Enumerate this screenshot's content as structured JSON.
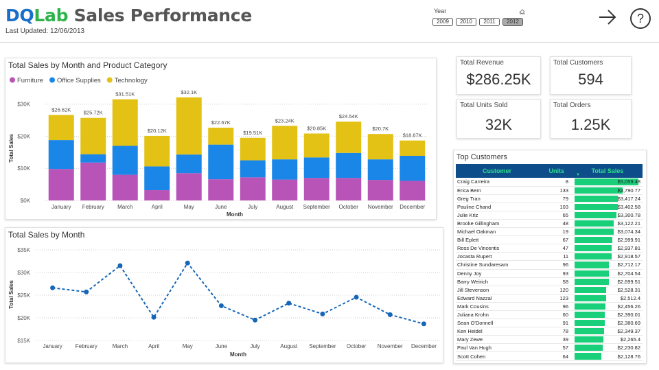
{
  "header": {
    "title_a": "DQ",
    "title_b": "Lab",
    "title_c": " Sales Performance",
    "last_updated": "Last Updated: 12/06/2013"
  },
  "slicer": {
    "label": "Year",
    "options": [
      "2009",
      "2010",
      "2011",
      "2012"
    ],
    "selected": "2012"
  },
  "colors": {
    "furniture": "#b854b8",
    "office": "#1a86e8",
    "technology": "#e3c115",
    "line": "#1566b8",
    "bar_green": "#19cf79",
    "table_header_bg": "#0d4d8a",
    "table_header_fg": "#2fe08a"
  },
  "icons": {
    "arrow": "arrow-right-icon",
    "help": "question-circle-icon",
    "eraser": "eraser-icon"
  },
  "kpis": [
    {
      "title": "Total Revenue",
      "value": "$286.25K"
    },
    {
      "title": "Total Customers",
      "value": "594"
    },
    {
      "title": "Total Units Sold",
      "value": "32K"
    },
    {
      "title": "Total Orders",
      "value": "1.25K"
    }
  ],
  "chart_data": [
    {
      "type": "bar",
      "stacked": true,
      "title": "Total Sales by Month and Product Category",
      "xlabel": "Month",
      "ylabel": "Total Sales",
      "ylim": [
        0,
        32500
      ],
      "yticks": [
        "$0K",
        "$10K",
        "$20K",
        "$30K"
      ],
      "legend_position": "top-left",
      "categories": [
        "January",
        "February",
        "March",
        "April",
        "May",
        "June",
        "July",
        "August",
        "September",
        "October",
        "November",
        "December"
      ],
      "series": [
        {
          "name": "Furniture",
          "values": [
            9800,
            11800,
            8000,
            3200,
            8500,
            6600,
            7200,
            6500,
            7000,
            7000,
            6400,
            6100
          ]
        },
        {
          "name": "Office Supplies",
          "values": [
            9000,
            2600,
            9000,
            7400,
            5800,
            10800,
            5300,
            6300,
            6400,
            7800,
            6400,
            7800
          ]
        },
        {
          "name": "Technology",
          "values": [
            7820,
            11320,
            14510,
            9520,
            17800,
            5270,
            7010,
            10440,
            7450,
            9740,
            7900,
            4770
          ]
        }
      ],
      "totals": [
        26620,
        25720,
        31510,
        20120,
        32100,
        22670,
        19510,
        23240,
        20850,
        24540,
        20700,
        18670
      ],
      "data_labels": [
        "$26.62K",
        "$25.72K",
        "$31.51K",
        "$20.12K",
        "$32.1K",
        "$22.67K",
        "$19.51K",
        "$23.24K",
        "$20.85K",
        "$24.54K",
        "$20.7K",
        "$18.67K"
      ]
    },
    {
      "type": "line",
      "title": "Total Sales by Month",
      "xlabel": "Month",
      "ylabel": "Total Sales",
      "ylim": [
        15000,
        35000
      ],
      "yticks": [
        "$15K",
        "$20K",
        "$25K",
        "$30K",
        "$35K"
      ],
      "categories": [
        "January",
        "February",
        "March",
        "April",
        "May",
        "June",
        "July",
        "August",
        "September",
        "October",
        "November",
        "December"
      ],
      "values": [
        26620,
        25720,
        31510,
        20120,
        32100,
        22670,
        19510,
        23240,
        20850,
        24540,
        20700,
        18670
      ]
    }
  ],
  "top_customers": {
    "title": "Top Customers",
    "columns": [
      "Customer",
      "Units",
      "Total Sales"
    ],
    "max_sales": 5059.48,
    "rows": [
      {
        "name": "Craig Carreira",
        "units": "8",
        "sales": "$5,059.48",
        "value": 5059.48
      },
      {
        "name": "Erica Bern",
        "units": "133",
        "sales": "$3,790.77",
        "value": 3790.77
      },
      {
        "name": "Greg Tran",
        "units": "79",
        "sales": "$3,417.24",
        "value": 3417.24
      },
      {
        "name": "Pauline Chand",
        "units": "103",
        "sales": "$3,402.58",
        "value": 3402.58
      },
      {
        "name": "Julie Kriz",
        "units": "65",
        "sales": "$3,300.78",
        "value": 3300.78
      },
      {
        "name": "Brooke Gillingham",
        "units": "48",
        "sales": "$3,122.21",
        "value": 3122.21
      },
      {
        "name": "Michael Oakman",
        "units": "19",
        "sales": "$3,074.34",
        "value": 3074.34
      },
      {
        "name": "Bill Eplett",
        "units": "67",
        "sales": "$2,999.91",
        "value": 2999.91
      },
      {
        "name": "Ross De Vincentis",
        "units": "47",
        "sales": "$2,937.81",
        "value": 2937.81
      },
      {
        "name": "Jocasta Rupert",
        "units": "11",
        "sales": "$2,918.57",
        "value": 2918.57
      },
      {
        "name": "Christine Sundaresam",
        "units": "96",
        "sales": "$2,712.17",
        "value": 2712.17
      },
      {
        "name": "Denny Joy",
        "units": "93",
        "sales": "$2,704.54",
        "value": 2704.54
      },
      {
        "name": "Barry Weirich",
        "units": "58",
        "sales": "$2,699.51",
        "value": 2699.51
      },
      {
        "name": "Jill Stevenson",
        "units": "120",
        "sales": "$2,528.31",
        "value": 2528.31
      },
      {
        "name": "Edward Nazzal",
        "units": "123",
        "sales": "$2,512.4",
        "value": 2512.4
      },
      {
        "name": "Mark Cousins",
        "units": "96",
        "sales": "$2,456.26",
        "value": 2456.26
      },
      {
        "name": "Juliana Krohn",
        "units": "60",
        "sales": "$2,390.01",
        "value": 2390.01
      },
      {
        "name": "Sean O'Donnell",
        "units": "91",
        "sales": "$2,380.69",
        "value": 2380.69
      },
      {
        "name": "Ken Heidel",
        "units": "78",
        "sales": "$2,349.37",
        "value": 2349.37
      },
      {
        "name": "Mary Zewe",
        "units": "39",
        "sales": "$2,265.4",
        "value": 2265.4
      },
      {
        "name": "Paul Van Hugh",
        "units": "57",
        "sales": "$2,230.82",
        "value": 2230.82
      },
      {
        "name": "Scott Cohen",
        "units": "64",
        "sales": "$2,128.76",
        "value": 2128.76
      }
    ]
  }
}
